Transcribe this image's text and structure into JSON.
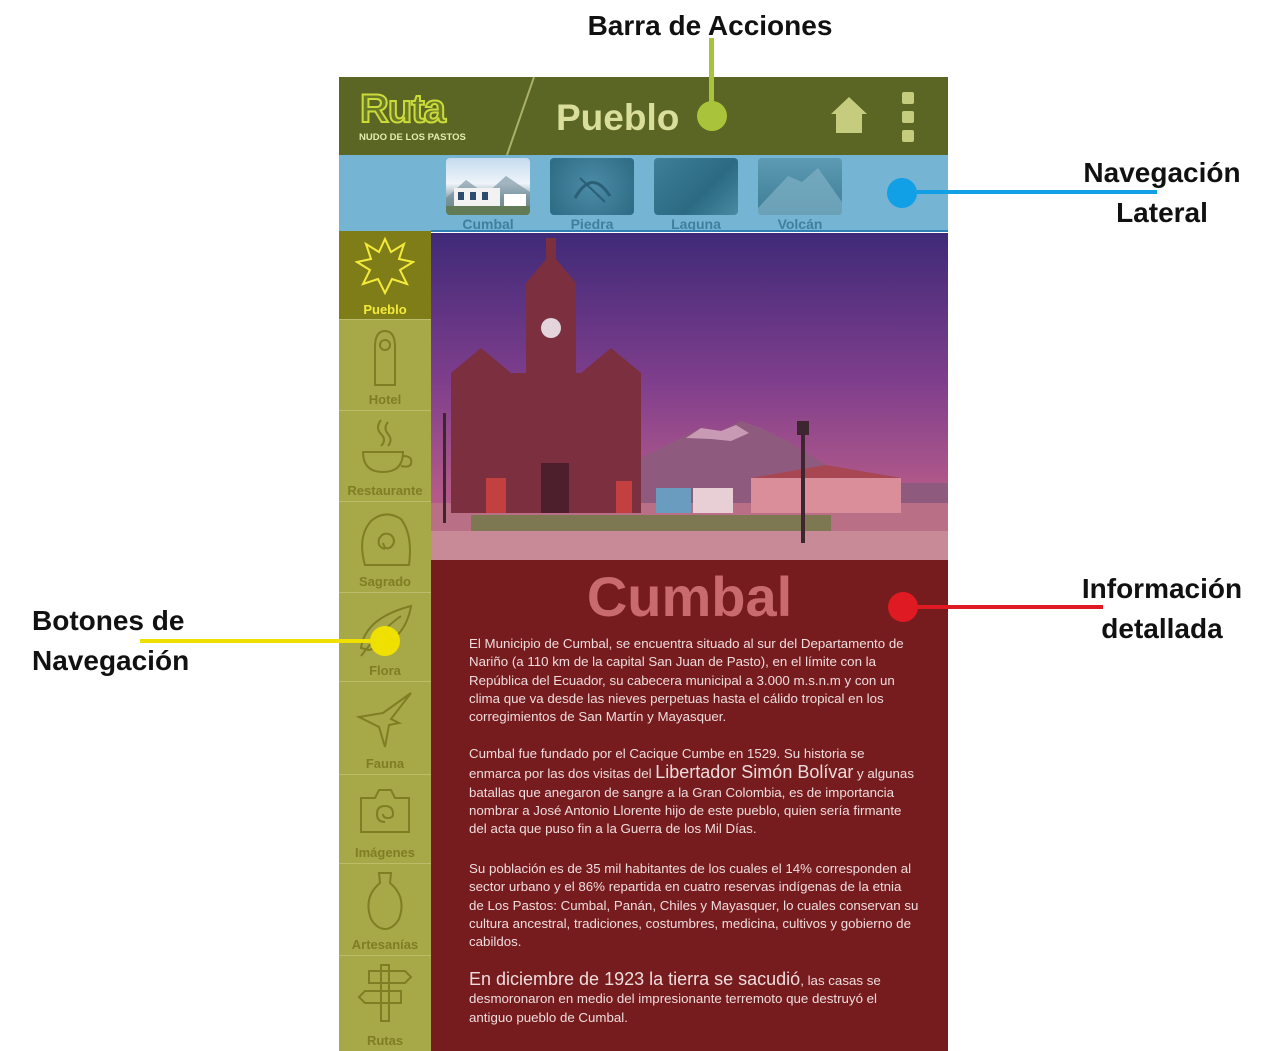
{
  "annotations": {
    "action_bar": "Barra de Acciones",
    "lateral_nav_line1": "Navegación",
    "lateral_nav_line2": "Lateral",
    "nav_buttons_line1": "Botones de",
    "nav_buttons_line2": "Navegación",
    "detail_info_line1": "Información",
    "detail_info_line2": "detallada"
  },
  "colors": {
    "action_bar_marker": "#a9c43a",
    "lateral_marker": "#119fe6",
    "nav_buttons_marker": "#f0e000",
    "detail_marker": "#e01a22"
  },
  "app": {
    "logo_text": "Ruta",
    "logo_subtitle": "NUDO DE LOS PASTOS",
    "title": "Pueblo",
    "home_icon": "home-icon",
    "menu_icon": "overflow-menu-icon"
  },
  "lateral_nav": [
    {
      "label": "Cumbal"
    },
    {
      "label": "Piedra"
    },
    {
      "label": "Laguna"
    },
    {
      "label": "Volcán"
    }
  ],
  "sidebar": [
    {
      "label": "Pueblo",
      "icon": "sun-star-icon",
      "active": true
    },
    {
      "label": "Hotel",
      "icon": "door-hanger-icon"
    },
    {
      "label": "Restaurante",
      "icon": "coffee-cup-icon"
    },
    {
      "label": "Sagrado",
      "icon": "spiral-stone-icon"
    },
    {
      "label": "Flora",
      "icon": "leaf-icon"
    },
    {
      "label": "Fauna",
      "icon": "hummingbird-icon"
    },
    {
      "label": "Imágenes",
      "icon": "camera-icon"
    },
    {
      "label": "Artesanías",
      "icon": "vase-icon"
    },
    {
      "label": "Rutas",
      "icon": "signpost-icon"
    }
  ],
  "content": {
    "title": "Cumbal",
    "p1": "El Municipio de Cumbal, se encuentra situado al sur del Departamento de Nariño (a 110 km de la capital San Juan de Pasto), en el límite con la República del Ecuador, su cabecera municipal a 3.000 m.s.n.m y con un clima que va desde las nieves perpetuas hasta el cálido tropical en los corregimientos de San Martín y Mayasquer.",
    "p2_a": "Cumbal fue fundado por el Cacique Cumbe en 1529. Su historia se enmarca por las dos visitas del ",
    "p2_highlight": "Libertador Simón Bolívar",
    "p2_b": " y algunas batallas que anegaron de sangre a la Gran Colombia, es de importancia nombrar a José Antonio Llorente hijo de este pueblo, quien sería firmante del acta que puso fin a la Guerra de los Mil Días.",
    "p3": "Su población es de 35 mil habitantes de los cuales el 14% corresponden al sector urbano y el 86% repartida en cuatro reservas indígenas de la etnia de Los Pastos: Cumbal, Panán, Chiles y Mayasquer, lo cuales conservan su cultura ancestral, tradiciones, costumbres, medicina, cultivos y gobierno de cabildos.",
    "p4_highlight": "En diciembre de 1923 la tierra se sacudió",
    "p4_rest": ", las casas se desmoronaron en medio del impresionante terremoto que destruyó el antiguo pueblo de Cumbal."
  }
}
